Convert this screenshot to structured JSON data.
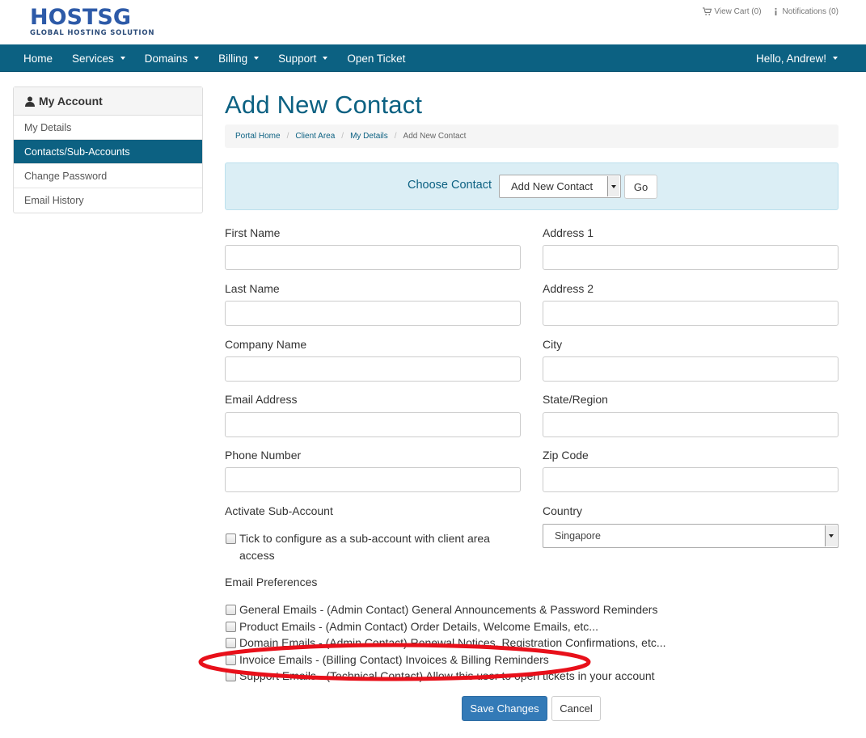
{
  "header": {
    "logo_main": "HOSTSG",
    "logo_sub": "GLOBAL HOSTING SOLUTION",
    "view_cart": "View Cart (0)",
    "notifications": "Notifications (0)"
  },
  "nav": {
    "items": [
      {
        "label": "Home",
        "dropdown": false
      },
      {
        "label": "Services",
        "dropdown": true
      },
      {
        "label": "Domains",
        "dropdown": true
      },
      {
        "label": "Billing",
        "dropdown": true
      },
      {
        "label": "Support",
        "dropdown": true
      },
      {
        "label": "Open Ticket",
        "dropdown": false
      }
    ],
    "user": "Hello, Andrew!"
  },
  "sidebar": {
    "title": "My Account",
    "items": [
      {
        "label": "My Details",
        "active": false
      },
      {
        "label": "Contacts/Sub-Accounts",
        "active": true
      },
      {
        "label": "Change Password",
        "active": false
      },
      {
        "label": "Email History",
        "active": false
      }
    ]
  },
  "main": {
    "title": "Add New Contact",
    "breadcrumb": [
      "Portal Home",
      "Client Area",
      "My Details",
      "Add New Contact"
    ],
    "choose_contact_label": "Choose Contact",
    "choose_contact_value": "Add New Contact",
    "go_label": "Go"
  },
  "form": {
    "first_name": "First Name",
    "last_name": "Last Name",
    "company_name": "Company Name",
    "email_address": "Email Address",
    "phone_number": "Phone Number",
    "address1": "Address 1",
    "address2": "Address 2",
    "city": "City",
    "state": "State/Region",
    "zip": "Zip Code",
    "country_label": "Country",
    "country_value": "Singapore",
    "activate_label": "Activate Sub-Account",
    "activate_text_1": "Tick to configure as a sub-account with client area",
    "activate_text_2": "access",
    "email_prefs_label": "Email Preferences",
    "email_prefs": [
      "General Emails - (Admin Contact) General Announcements & Password Reminders",
      "Product Emails - (Admin Contact) Order Details, Welcome Emails, etc...",
      "Domain Emails - (Admin Contact) Renewal Notices, Registration Confirmations, etc...",
      "Invoice Emails - (Billing Contact) Invoices & Billing Reminders",
      "Support Emails - (Technical Contact) Allow this user to open tickets in your account"
    ],
    "save_label": "Save Changes",
    "cancel_label": "Cancel"
  },
  "colors": {
    "brand": "#0c6182",
    "logo": "#2d5aa8",
    "primary_button": "#337ab7",
    "annotation": "#e8101a"
  }
}
